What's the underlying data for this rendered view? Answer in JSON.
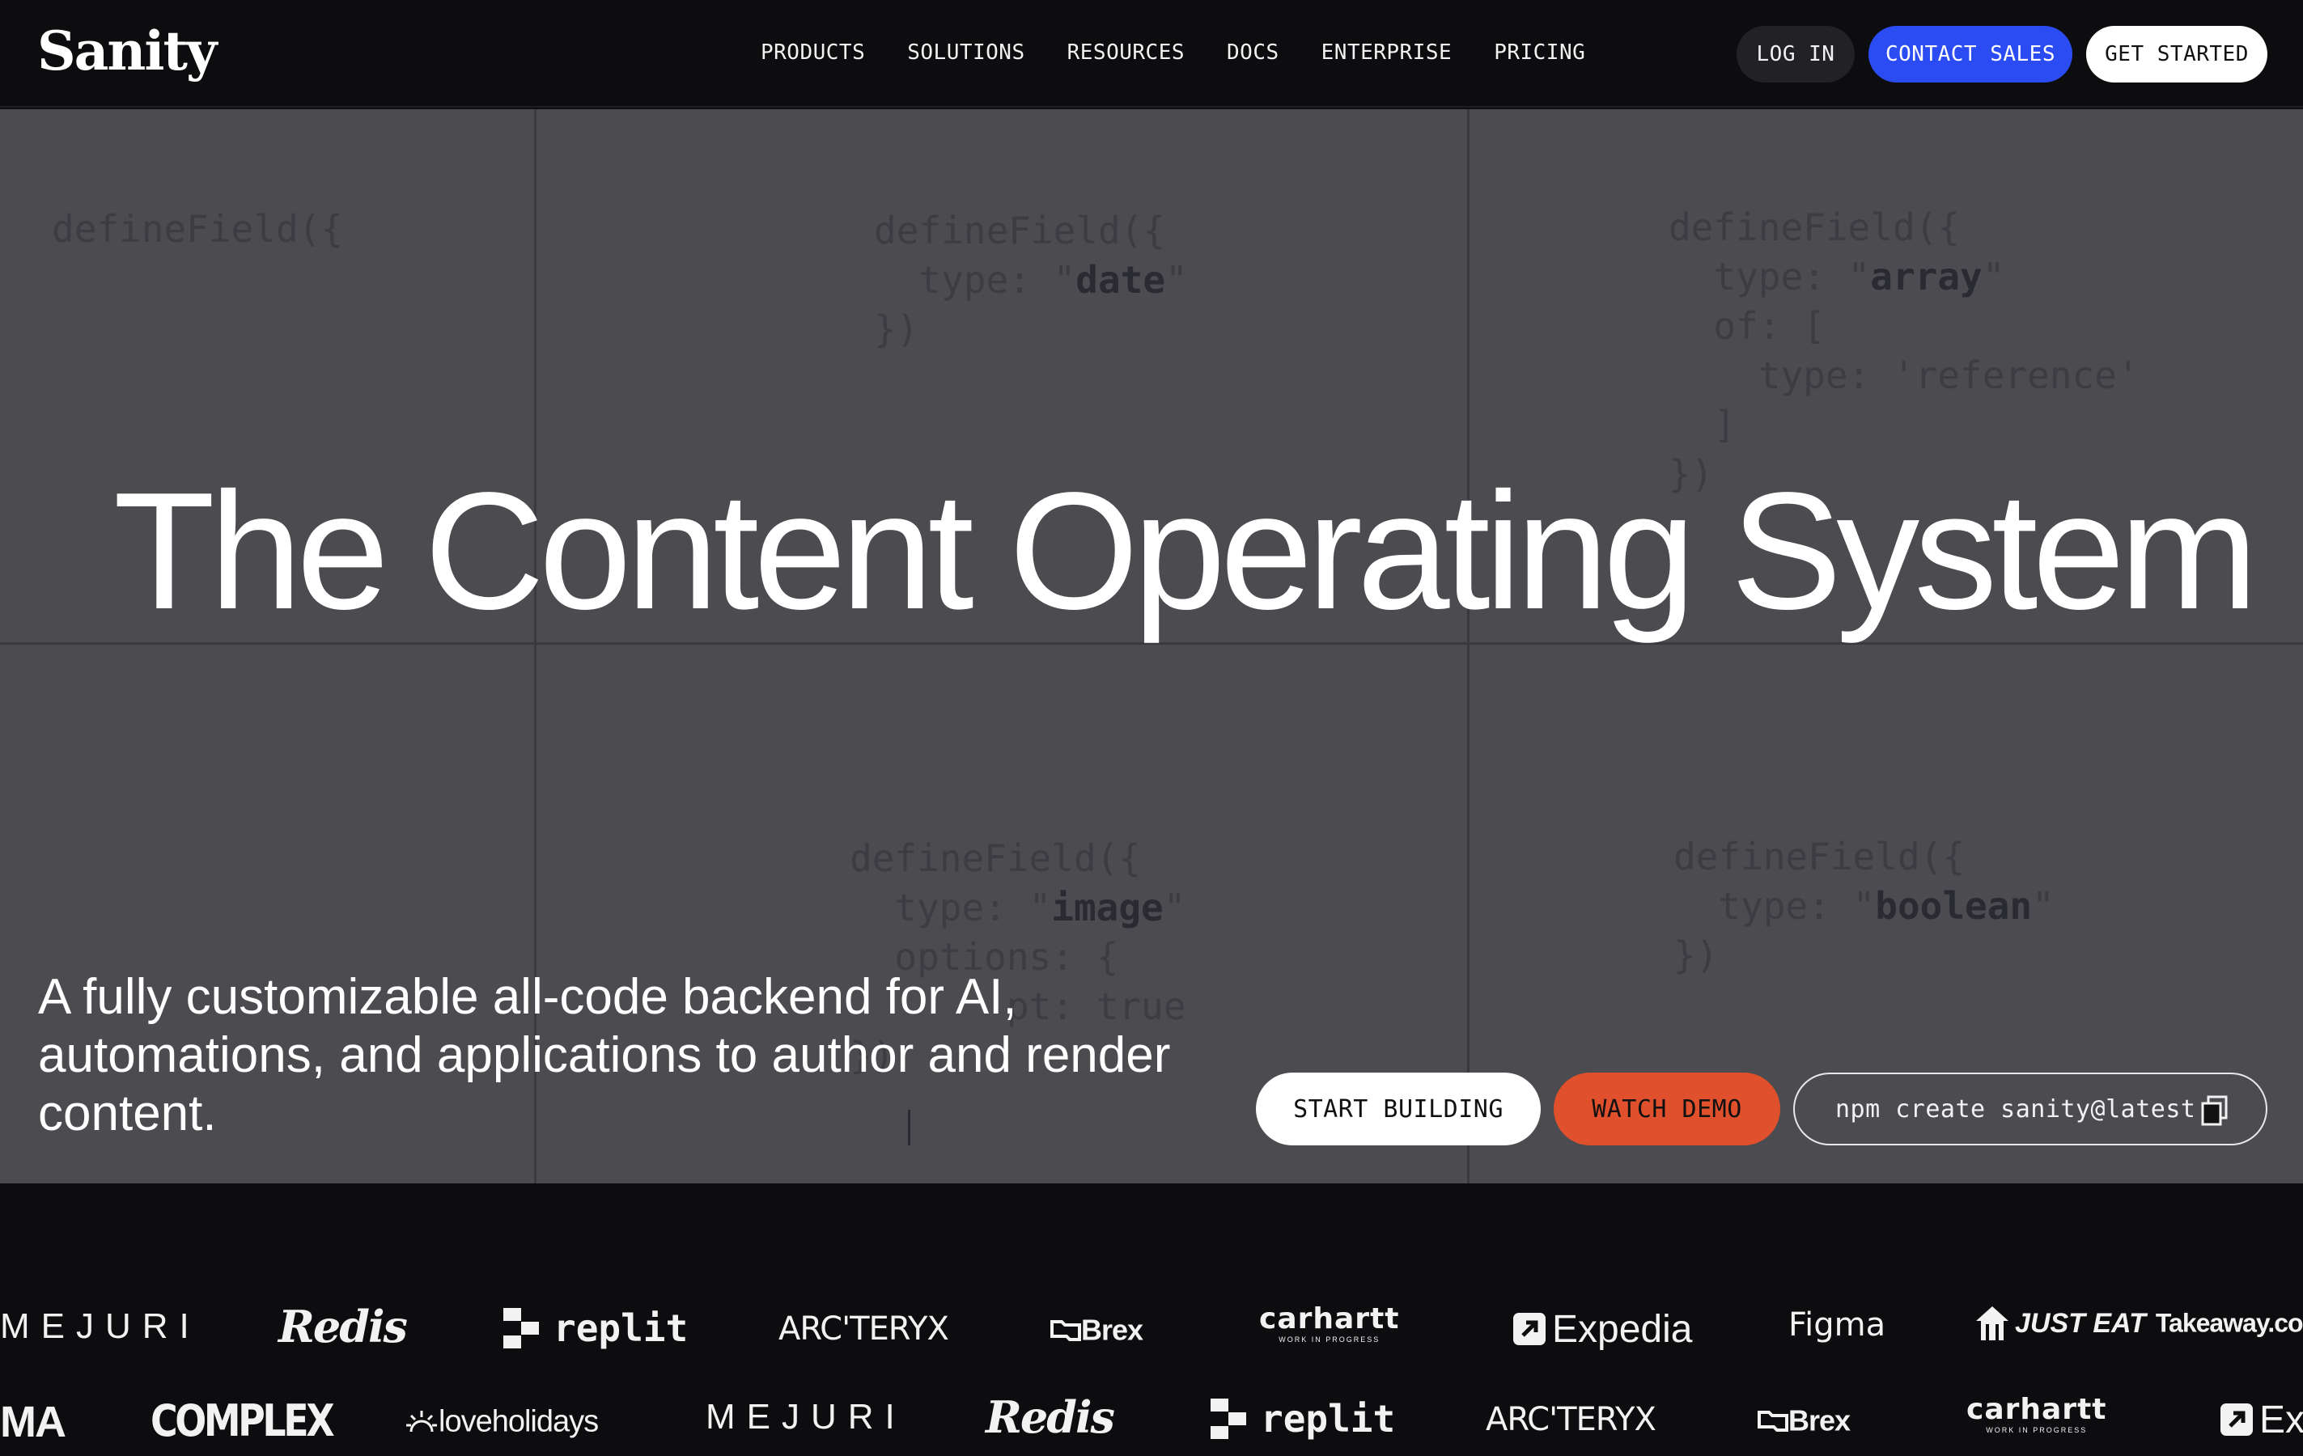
{
  "nav": {
    "logo": "Sanity",
    "links": [
      "PRODUCTS",
      "SOLUTIONS",
      "RESOURCES",
      "DOCS",
      "ENTERPRISE",
      "PRICING"
    ],
    "login": "LOG IN",
    "contact": "CONTACT SALES",
    "get_started": "GET STARTED"
  },
  "hero": {
    "headline": "The Content Operating System",
    "subtext": "A fully customizable all-code backend for AI, automations, and applications to author and render content.",
    "cta_build": "START BUILDING",
    "cta_demo": "WATCH DEMO",
    "npm_command": "npm create sanity@latest",
    "code_snippets": {
      "c1": "defineField({",
      "c2_l1": "defineField({",
      "c2_l2a": "  type: \"",
      "c2_l2b": "date",
      "c2_l2c": "\"",
      "c2_l3": "})",
      "c3_l1": "defineField({",
      "c3_l2a": "  type: \"",
      "c3_l2b": "array",
      "c3_l2c": "\"",
      "c3_l3": "  of: [",
      "c3_l4": "    type: 'reference'",
      "c3_l5": "  ]",
      "c3_l6": "})",
      "c4_l1": "defineField({",
      "c4_l2a": "  type: \"",
      "c4_l2b": "image",
      "c4_l2c": "\"",
      "c4_l3": "  options: {",
      "c4_l4": "       pt: true",
      "c4_l5": "})",
      "c5_l1": "defineField({",
      "c5_l2a": "  type: \"",
      "c5_l2b": "boolean",
      "c5_l2c": "\"",
      "c5_l3": "})"
    }
  },
  "logos": {
    "row1": [
      "MEJURI",
      "Redis",
      "replit",
      "ARC'TERYX",
      "Brex",
      "carhartt",
      "WORK IN PROGRESS",
      "Expedia",
      "Figma",
      "JUST EAT",
      "Takeaway.com"
    ],
    "row2": [
      "MA",
      "COMPLEX",
      "loveholidays",
      "MEJURI",
      "Redis",
      "replit",
      "ARC'TERYX",
      "Brex",
      "carhartt",
      "WORK IN PROGRESS",
      "Exp"
    ]
  },
  "colors": {
    "nav_bg": "#0d0d10",
    "hero_bg": "#4c4b50",
    "contact_blue": "#2b4cf2",
    "demo_orange": "#e0502c"
  }
}
